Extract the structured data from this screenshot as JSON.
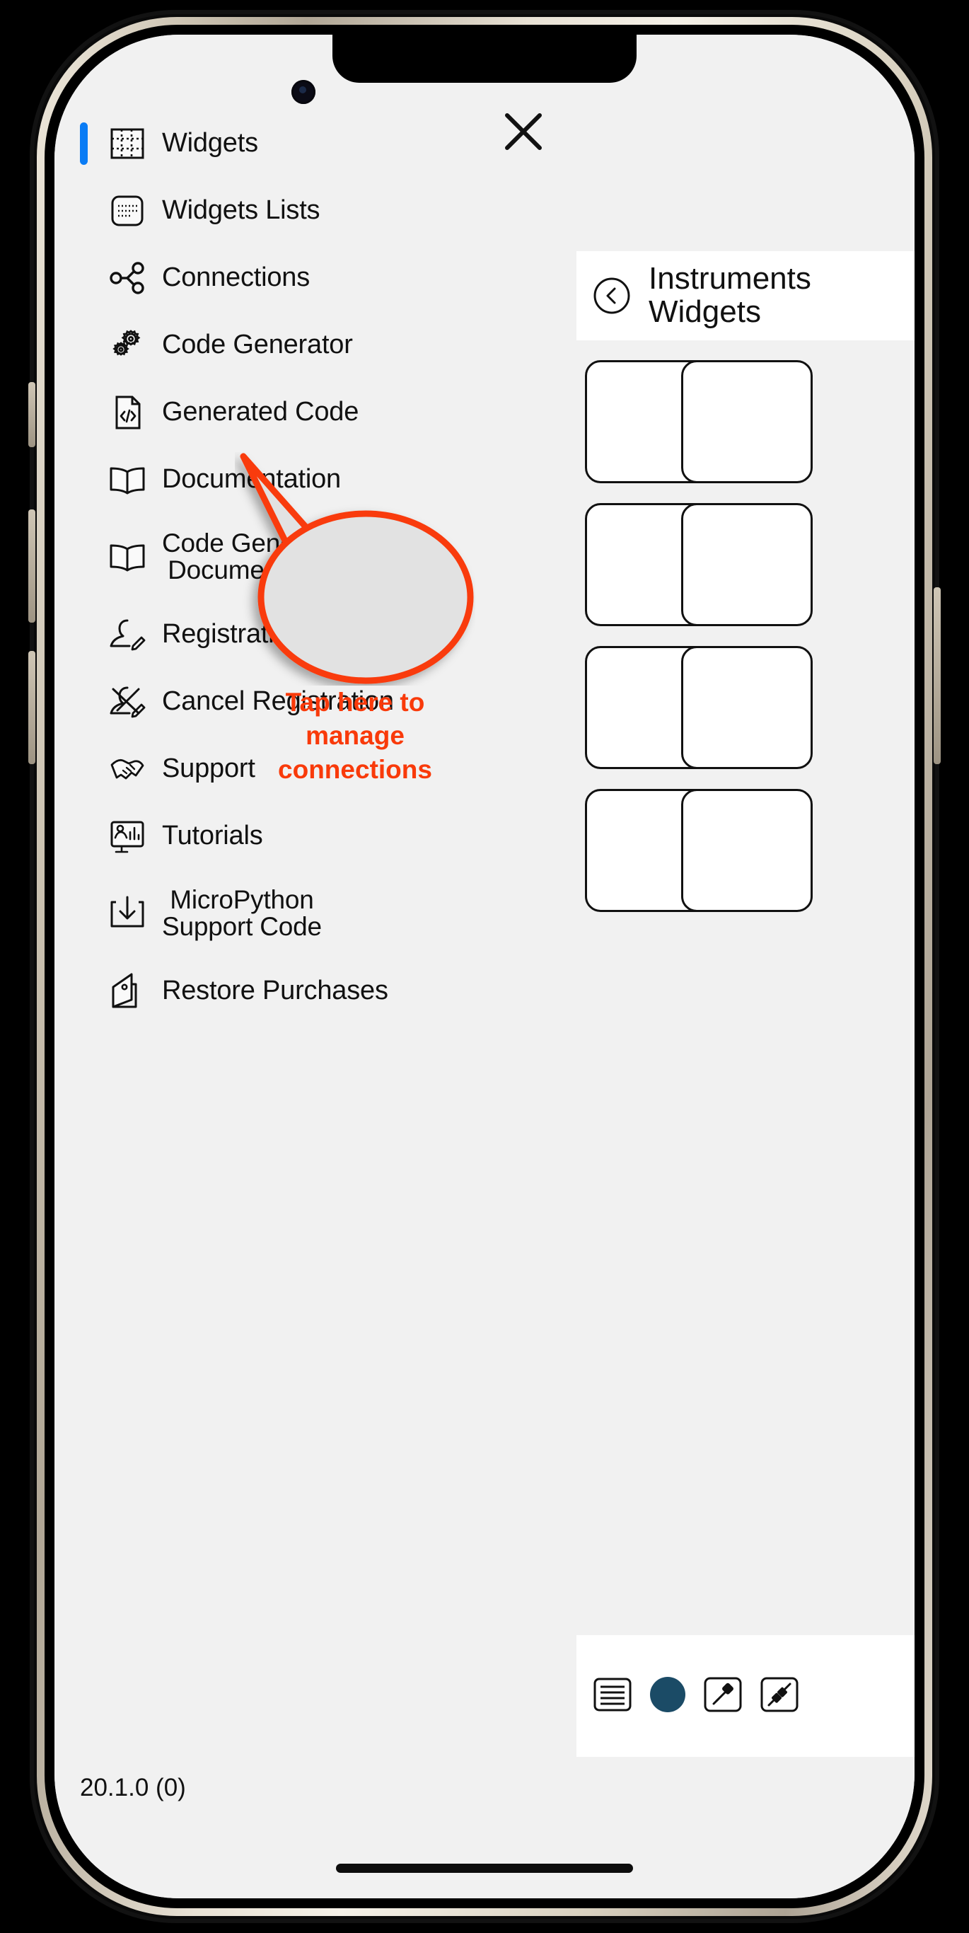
{
  "app": {
    "version": "20.1.0 (0)"
  },
  "drawer": {
    "close_icon": "close-icon",
    "items": [
      {
        "label": "Widgets",
        "icon": "grid-icon",
        "selected": true
      },
      {
        "label": "Widgets Lists",
        "icon": "list-rounded-icon",
        "selected": false
      },
      {
        "label": "Connections",
        "icon": "share-nodes-icon",
        "selected": false
      },
      {
        "label": "Code Generator",
        "icon": "gears-icon",
        "selected": false
      },
      {
        "label": "Generated Code",
        "icon": "code-file-icon",
        "selected": false
      },
      {
        "label": "Documentation",
        "icon": "open-book-icon",
        "selected": false
      },
      {
        "label": "Code Generator Documentation",
        "icon": "open-book-icon",
        "selected": false,
        "two_line": [
          "Code Generator",
          "Documentation"
        ]
      },
      {
        "label": "Registration",
        "icon": "user-edit-icon",
        "selected": false
      },
      {
        "label": "Cancel Registration",
        "icon": "user-edit-cancel-icon",
        "selected": false
      },
      {
        "label": "Support",
        "icon": "handshake-icon",
        "selected": false
      },
      {
        "label": "Tutorials",
        "icon": "presentation-icon",
        "selected": false
      },
      {
        "label": "MicroPython Support Code",
        "icon": "download-icon",
        "selected": false,
        "two_line": [
          "MicroPython",
          "Support Code"
        ]
      },
      {
        "label": "Restore Purchases",
        "icon": "receipt-icon",
        "selected": false
      }
    ]
  },
  "content": {
    "back_icon": "back-circle-icon",
    "title_line1": "Instruments",
    "title_line2": "Widgets",
    "toolbar": [
      {
        "icon": "menu-lines-icon"
      },
      {
        "icon": "circle-filled-icon"
      },
      {
        "icon": "plug-connected-icon"
      },
      {
        "icon": "plug-disconnected-icon"
      }
    ]
  },
  "callout": {
    "text": "Tap here to manage connections",
    "lines": [
      "Tap here to",
      "manage",
      "connections"
    ],
    "color": "#f93a0a",
    "fill": "#e2e2e2"
  },
  "colors": {
    "accent_blue": "#0a7cf5",
    "screen_bg": "#f1f1f1",
    "callout_red": "#f93a0a",
    "toolbar_circle": "#1b4b66"
  }
}
